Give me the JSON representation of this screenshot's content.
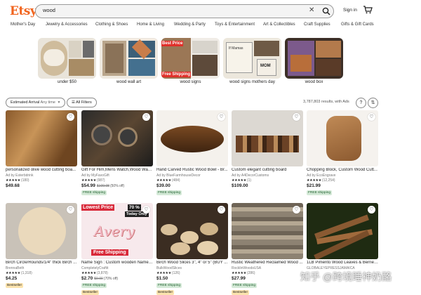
{
  "header": {
    "logo": "Etsy",
    "search_value": "wood",
    "clear_glyph": "✕",
    "sign_in": "Sign in",
    "accent": "#f1641e"
  },
  "categories": [
    "Mother's Day",
    "Jewelry & Accessories",
    "Clothing & Shoes",
    "Home & Living",
    "Wedding & Party",
    "Toys & Entertainment",
    "Art & Collectibles",
    "Craft Supplies",
    "Gifts & Gift Cards"
  ],
  "suggestions": [
    "under $50",
    "wood wall art",
    "wood signs",
    "wood signs mothers day",
    "wood box"
  ],
  "filters": {
    "arrival": "Estimated Arrival",
    "arrival_value": "Any time",
    "all_filters": "All Filters",
    "results": "3,787,803 results, with Ads"
  },
  "products": [
    {
      "title": "personalized olive wood cutting boa...",
      "seller": "Ad by Esterbdrink",
      "reviews": "(180)",
      "price": "$49.68",
      "orig": "",
      "disc": "",
      "badge": "",
      "best": ""
    },
    {
      "title": "Gift For Him,Mens Watch,Wood Watc...",
      "seller": "Ad by MyFavoGift",
      "reviews": "(987)",
      "price": "$54.99",
      "orig": "$109.98",
      "disc": "(50% off)",
      "badge": "FREE shipping",
      "best": ""
    },
    {
      "title": "Hand Carved Rustic Wood Bowl - Br...",
      "seller": "Ad by BlueFarmhouseDecor",
      "reviews": "(484)",
      "price": "$39.00",
      "orig": "",
      "disc": "",
      "badge": "FREE shipping",
      "best": ""
    },
    {
      "title": "Custom elegant cutting board",
      "seller": "Ad by A4DecorCustoms",
      "reviews": "(1)",
      "price": "$109.00",
      "orig": "",
      "disc": "",
      "badge": "",
      "best": ""
    },
    {
      "title": "Chopping Block, Custom Wood Cutt...",
      "seller": "Ad by EcoEngrave",
      "reviews": "(12,254)",
      "price": "$21.99",
      "orig": "",
      "disc": "",
      "badge": "FREE shipping",
      "best": ""
    },
    {
      "title": "Birch Circle/Rounds/1/4\" thick Birch ...",
      "seller": "BrennaBeth",
      "reviews": "(1,318)",
      "price": "$4.25",
      "orig": "",
      "disc": "",
      "badge": "",
      "best": "Bestseller"
    },
    {
      "title": "Name Sign : Custom wooden Name ...",
      "seller": "CompletelyCraftit",
      "reviews": "(3,878)",
      "price": "$2.70",
      "orig": "$9.00",
      "disc": "(70% off)",
      "badge": "FREE shipping",
      "best": "Bestseller"
    },
    {
      "title": "Birch Wood Slices 3\", 4\" or 5\" (BUY ...",
      "seller": "BulkWoodSlices",
      "reviews": "(126)",
      "price": "$1.50",
      "orig": "",
      "disc": "",
      "badge": "FREE shipping",
      "best": "Bestseller"
    },
    {
      "title": "Rustic Weathered Reclaimed Wood ...",
      "seller": "RocklinWoodsUSA",
      "reviews": "(286)",
      "price": "$27.99",
      "orig": "",
      "disc": "",
      "badge": "FREE shipping",
      "best": "Bestseller"
    },
    {
      "title": "1LB Pimento Wood Leaves & Berries ...",
      "seller": "GLOBALEYEPRESSJAMAICA",
      "reviews": "",
      "price": "",
      "orig": "",
      "disc": "",
      "badge": "",
      "best": ""
    }
  ],
  "stars": "★★★★★",
  "heart_glyph": "♡",
  "image_text": {
    "tile2_line1": "Best Price",
    "tile2_line2": "Free Shipping",
    "tile3_line1": "If Mamas",
    "tile3_line2": "MOM",
    "p6_line1": "Lowest Price",
    "p6_line2": "70 %",
    "p6_line3": "Today Only",
    "p6_name": "Avery",
    "p6_line4": "Free Shipping"
  },
  "watermark": "知乎 @跨境睡神奶酪"
}
